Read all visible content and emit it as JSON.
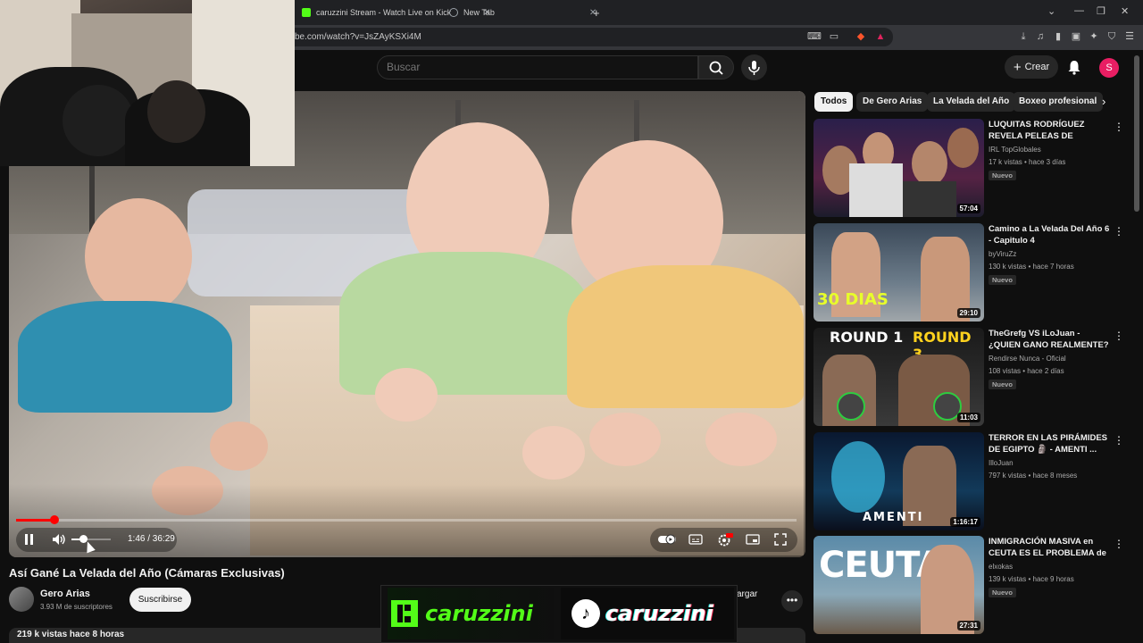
{
  "browser": {
    "tabs": [
      {
        "label": "caruzzini Stream - Watch Live on Kick",
        "icon": "kick-icon",
        "color": "#53fc18"
      },
      {
        "label": "New Tab",
        "icon": "newtab-icon",
        "color": "#9aa0a6"
      }
    ],
    "new_tab": "+",
    "url": "be.com/watch?v=JsZAyKSXi4M"
  },
  "header": {
    "search_placeholder": "Buscar",
    "create_label": "Crear",
    "user_initial": "S"
  },
  "player": {
    "current_time": "1:46",
    "duration": "36:29",
    "time_display": "1:46 / 36:29",
    "progress_fraction": 0.049,
    "volume_fraction": 0.3
  },
  "video": {
    "title": "Así Gané La Velada del Año (Cámaras Exclusivas)",
    "channel": "Gero Arias",
    "subscribers": "3.93 M de suscriptores",
    "subscribe_label": "Suscribirse",
    "download_label": "scargar",
    "views": "219 k vistas  hace 8 horas"
  },
  "overlay": {
    "kick_brand": "caruzzini",
    "tiktok_brand": "caruzzini"
  },
  "chips": [
    "Todos",
    "De Gero Arias",
    "La Velada del Año",
    "Boxeo profesional"
  ],
  "recommendations": [
    {
      "title": "LUQUITAS RODRÍGUEZ REVELA PELEAS DE PARENSE DE ...",
      "channel": "IRL TopGlobales",
      "meta": "17 k vistas • hace 3 días",
      "badge": "Nuevo",
      "duration": "57:04"
    },
    {
      "title": "Camino a La Velada Del Año 6 - Capitulo 4",
      "channel": "byViruZz",
      "meta": "130 k vistas • hace 7 horas",
      "badge": "Nuevo",
      "duration": "29:10",
      "thumb_text": "30 DIAS"
    },
    {
      "title": "TheGrefg VS iLoJuan - ¿QUIEN GANO REALMENTE? - ANALIS...",
      "channel": "Rendirse Nunca - Oficial",
      "meta": "108 vistas • hace 2 días",
      "badge": "Nuevo",
      "duration": "11:03",
      "thumb_text_left": "ROUND 1",
      "thumb_text_right": "ROUND 3"
    },
    {
      "title": "TERROR EN LAS PIRÁMIDES DE EGIPTO 🗿 - AMENTI ...",
      "channel": "IlloJuan",
      "meta": "797 k vistas • hace 8 meses",
      "badge": "",
      "duration": "1:16:17",
      "thumb_text": "AMENTI"
    },
    {
      "title": "INMIGRACIÓN MASIVA en CEUTA ES EL PROBLEMA de ...",
      "channel": "elxokas",
      "meta": "139 k vistas • hace 9 horas",
      "badge": "Nuevo",
      "duration": "27:31",
      "thumb_text": "CEUTA"
    }
  ]
}
